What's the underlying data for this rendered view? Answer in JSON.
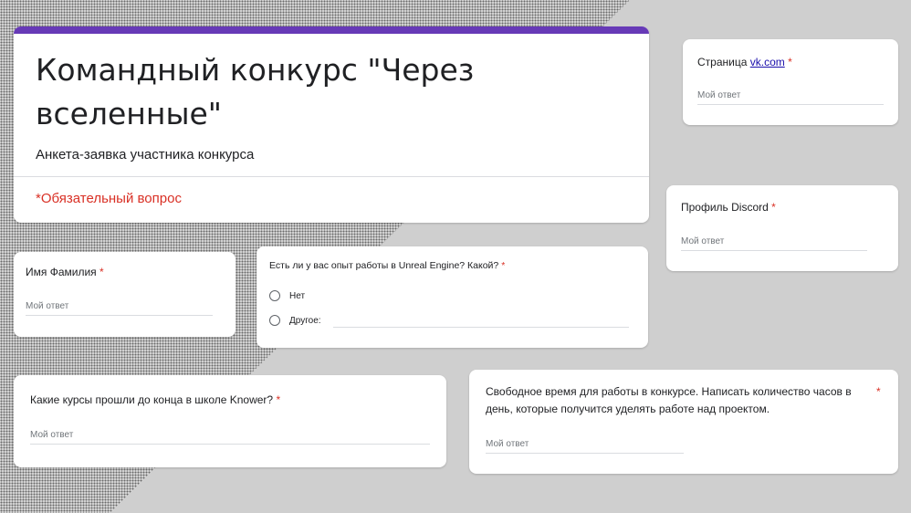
{
  "form": {
    "title": "Командный конкурс \"Через вселенные\"",
    "description": "Анкета-заявка участника конкурса",
    "required_note": "*Обязательный вопрос"
  },
  "questions": {
    "name": {
      "label": "Имя Фамилия",
      "required": "*",
      "placeholder": "Мой ответ"
    },
    "unreal": {
      "label": "Есть ли у вас опыт работы в Unreal Engine? Какой?",
      "required": "*",
      "options": [
        "Нет",
        "Другое:"
      ]
    },
    "courses": {
      "label": "Какие курсы прошли до конца в школе Knower?",
      "required": "*",
      "placeholder": "Мой ответ"
    },
    "free_time": {
      "label_line1": "Свободное время для работы в конкурсе. Написать количество часов в",
      "label_line2": "день, которые получится уделять работе над проектом.",
      "required": "*",
      "placeholder": "Мой ответ"
    },
    "vk": {
      "label_prefix": "Страница ",
      "link": "vk.com",
      "required": "*",
      "placeholder": "Мой ответ"
    },
    "discord": {
      "label": "Профиль Discord",
      "required": "*",
      "placeholder": "Мой ответ"
    }
  },
  "colors": {
    "accent": "#673ab7",
    "required": "#d93025",
    "link": "#1a0dab"
  }
}
